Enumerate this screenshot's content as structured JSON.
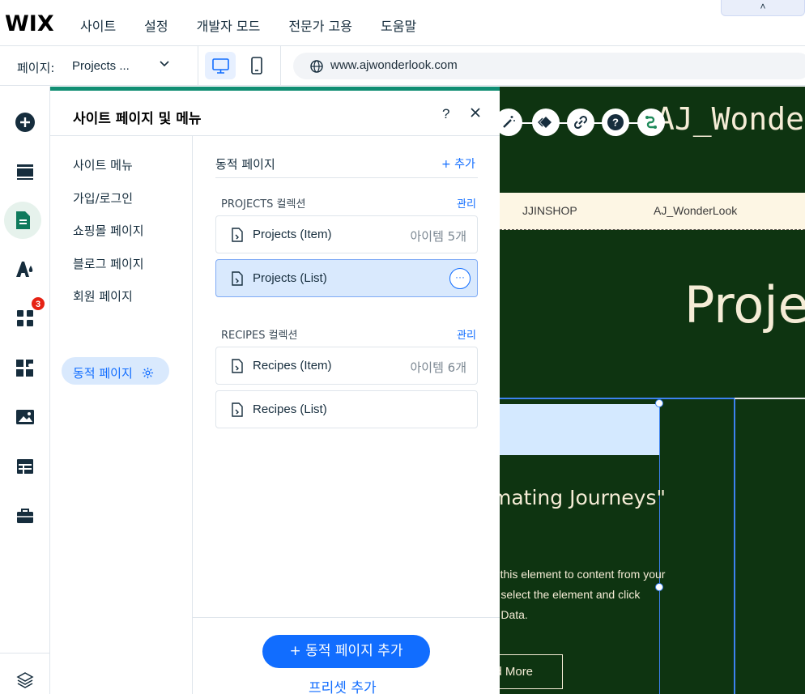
{
  "topbar": {
    "logo": "WIX",
    "menu": [
      "사이트",
      "설정",
      "개발자 모드",
      "전문가 고용",
      "도움말"
    ],
    "collapse_glyph": "˄"
  },
  "secondbar": {
    "page_label": "페이지:",
    "page_value": "Projects ...",
    "url": "www.ajwonderlook.com"
  },
  "leftrail": {
    "badge_count": "3",
    "icons": [
      "add-icon",
      "sections-icon",
      "pages-icon",
      "design-icon",
      "apps-icon",
      "business-apps-icon",
      "media-icon",
      "cms-icon",
      "portfolio-icon",
      "layers-icon"
    ]
  },
  "panel": {
    "title": "사이트 페이지 및 메뉴",
    "help": "?",
    "close": "✕",
    "nav": [
      "사이트 메뉴",
      "가입/로그인",
      "쇼핑몰 페이지",
      "블로그 페이지",
      "회원 페이지",
      "동적 페이지"
    ],
    "section_title": "동적 페이지",
    "add_label": "+ 추가",
    "collections": [
      {
        "label": "PROJECTS 컬렉션",
        "manage": "관리",
        "pages": [
          {
            "label": "Projects (Item)",
            "count": "아이템 5개"
          },
          {
            "label": "Projects (List)",
            "count": ""
          }
        ]
      },
      {
        "label": "RECIPES 컬렉션",
        "manage": "관리",
        "pages": [
          {
            "label": "Recipes (Item)",
            "count": "아이템 6개"
          },
          {
            "label": "Recipes (List)",
            "count": ""
          }
        ]
      }
    ],
    "more_label": "···",
    "add_dynamic_button": "+ 동적 페이지 추가",
    "preset_link": "프리셋 추가"
  },
  "canvas": {
    "site_title": "AJ_Wonde",
    "nav": [
      "JJINSHOP",
      "AJ_WonderLook"
    ],
    "big_title": "Projec",
    "heading": "mating Journeys\"",
    "body_lines": [
      "ect this element to content from your",
      "on, select the element and click",
      "t to Data."
    ],
    "read_more": "ad More"
  }
}
